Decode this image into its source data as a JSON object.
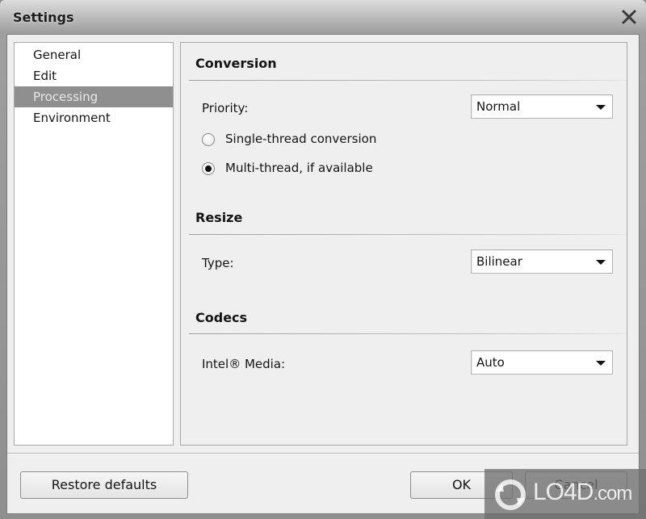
{
  "window": {
    "title": "Settings",
    "close_icon": "close-icon"
  },
  "sidebar": {
    "items": [
      {
        "label": "General",
        "selected": false
      },
      {
        "label": "Edit",
        "selected": false
      },
      {
        "label": "Processing",
        "selected": true
      },
      {
        "label": "Environment",
        "selected": false
      }
    ]
  },
  "conversion": {
    "title": "Conversion",
    "priority_label": "Priority:",
    "priority_value": "Normal",
    "radio_single": {
      "label": "Single-thread conversion",
      "checked": false
    },
    "radio_multi": {
      "label": "Multi-thread, if available",
      "checked": true
    }
  },
  "resize": {
    "title": "Resize",
    "type_label": "Type:",
    "type_value": "Bilinear"
  },
  "codecs": {
    "title": "Codecs",
    "intel_label": "Intel® Media:",
    "intel_value": "Auto"
  },
  "footer": {
    "restore_label": "Restore defaults",
    "ok_label": "OK",
    "cancel_label": "Cancel"
  },
  "watermark": {
    "brand": "LO4D",
    "suffix": ".com"
  }
}
